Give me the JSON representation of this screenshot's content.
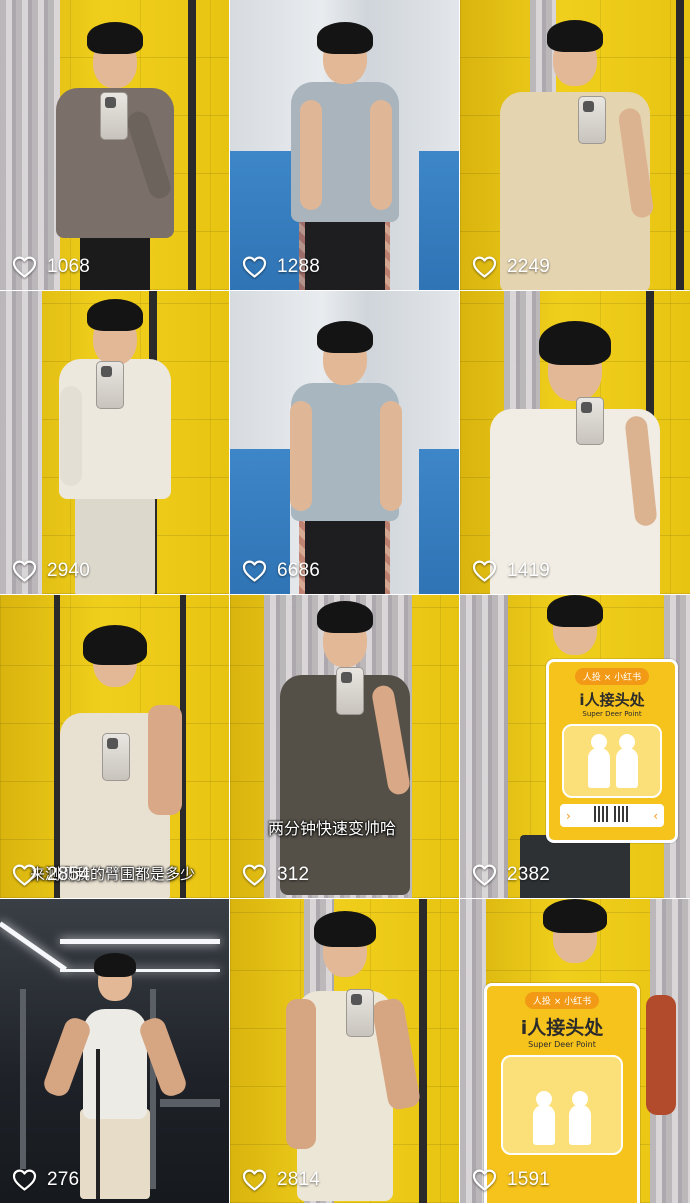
{
  "tiles": [
    {
      "likes": "1068"
    },
    {
      "likes": "1288"
    },
    {
      "likes": "2249"
    },
    {
      "likes": "2940"
    },
    {
      "likes": "6686"
    },
    {
      "likes": "1419"
    },
    {
      "likes": "2854",
      "caption": "来测测我的臂围都是多少"
    },
    {
      "likes": "312",
      "caption": "两分钟快速变帅哈"
    },
    {
      "likes": "2382",
      "sign": {
        "top": "人投 × 小红书",
        "title": "i人接头处",
        "subtitle": "Super Deer Point"
      }
    },
    {
      "likes": "276"
    },
    {
      "likes": "2814"
    },
    {
      "likes": "1591",
      "sign": {
        "top": "人投 × 小红书",
        "title": "i人接头处",
        "subtitle": "Super Deer Point"
      }
    }
  ],
  "icons": {
    "like": "heart-outline-icon"
  },
  "colors": {
    "overlay_text": "#ffffff",
    "wall_yellow": "#f0cf1c",
    "sign_yellow": "#f6c21c",
    "sign_orange": "#f29a16"
  }
}
